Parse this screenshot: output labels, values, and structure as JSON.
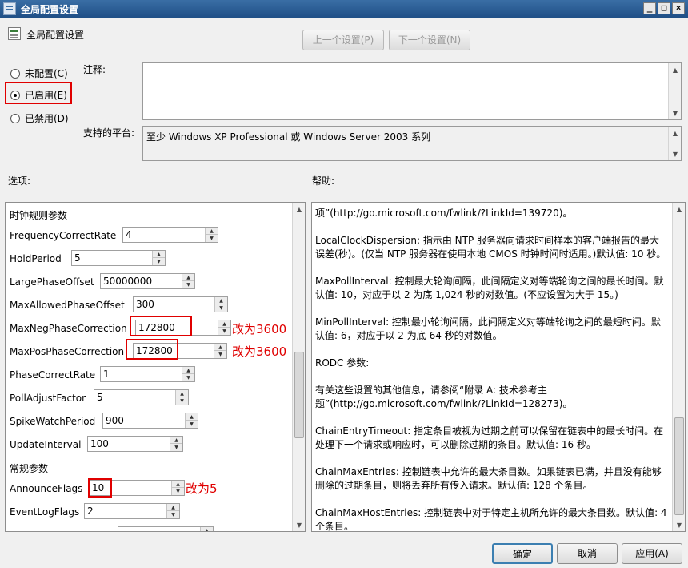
{
  "window": {
    "title": "全局配置设置"
  },
  "header": {
    "title": "全局配置设置",
    "prev_button": "上一个设置(P)",
    "next_button": "下一个设置(N)"
  },
  "state": {
    "not_configured": "未配置(C)",
    "enabled": "已启用(E)",
    "disabled": "已禁用(D)",
    "selected": "enabled"
  },
  "comment": {
    "label": "注释:",
    "value": ""
  },
  "platform": {
    "label": "支持的平台:",
    "value": "至少 Windows XP Professional 或 Windows Server 2003 系列"
  },
  "options": {
    "label": "选项:",
    "section_clock": "时钟规则参数",
    "section_general": "常规参数",
    "rows": [
      {
        "name": "FrequencyCorrectRate",
        "value": "4"
      },
      {
        "name": "HoldPeriod",
        "value": "5"
      },
      {
        "name": "LargePhaseOffset",
        "value": "50000000"
      },
      {
        "name": "MaxAllowedPhaseOffset",
        "value": "300"
      },
      {
        "name": "MaxNegPhaseCorrection",
        "value": "172800"
      },
      {
        "name": "MaxPosPhaseCorrection",
        "value": "172800"
      },
      {
        "name": "PhaseCorrectRate",
        "value": "1"
      },
      {
        "name": "PollAdjustFactor",
        "value": "5"
      },
      {
        "name": "SpikeWatchPeriod",
        "value": "900"
      },
      {
        "name": "UpdateInterval",
        "value": "100"
      },
      {
        "name": "AnnounceFlags",
        "value": "10"
      },
      {
        "name": "EventLogFlags",
        "value": "2"
      }
    ]
  },
  "annotations": {
    "max_neg": "改为3600",
    "max_pos": "改为3600",
    "announce": "改为5"
  },
  "help": {
    "label": "帮助:",
    "paragraphs": [
      "项”(http://go.microsoft.com/fwlink/?LinkId=139720)。",
      "LocalClockDispersion: 指示由 NTP 服务器向请求时间样本的客户端报告的最大误差(秒)。(仅当 NTP 服务器在使用本地 CMOS 时钟时间时适用。)默认值: 10 秒。",
      "MaxPollInterval: 控制最大轮询间隔，此间隔定义对等端轮询之间的最长时间。默认值: 10，对应于以 2 为底 1,024 秒的对数值。(不应设置为大于 15。)",
      "MinPollInterval: 控制最小轮询间隔，此间隔定义对等端轮询之间的最短时间。默认值: 6，对应于以 2 为底 64 秒的对数值。",
      "RODC 参数:",
      "有关这些设置的其他信息，请参阅“附录 A: 技术参考主题”(http://go.microsoft.com/fwlink/?LinkId=128273)。",
      "ChainEntryTimeout: 指定条目被视为过期之前可以保留在链表中的最长时间。在处理下一个请求或响应时，可以删除过期的条目。默认值: 16 秒。",
      "ChainMaxEntries: 控制链表中允许的最大条目数。如果链表已满，并且没有能够删除的过期条目，则将丢弃所有传入请求。默认值: 128 个条目。",
      "ChainMaxHostEntries: 控制链表中对于特定主机所允许的最大条目数。默认值: 4 个条目。"
    ]
  },
  "footer": {
    "ok": "确定",
    "cancel": "取消",
    "apply": "应用(A)"
  }
}
